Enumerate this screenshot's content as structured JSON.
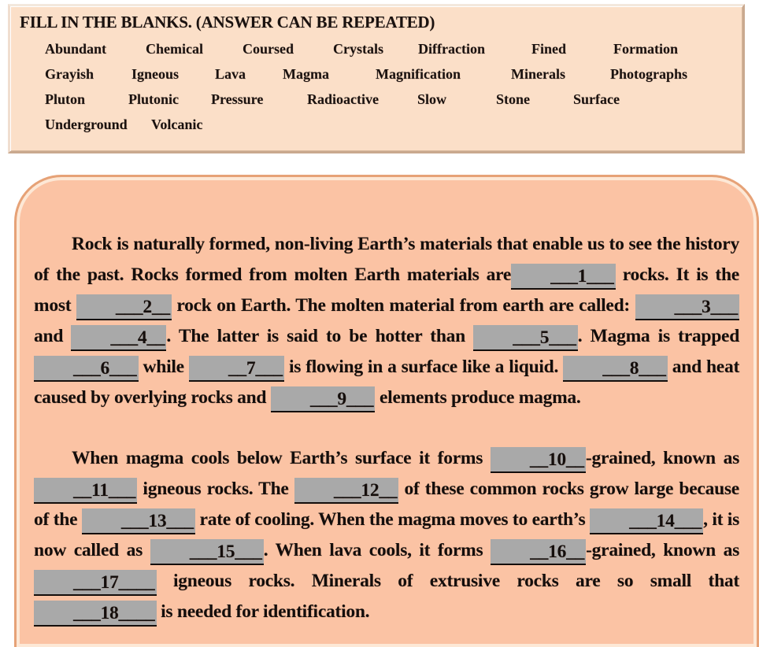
{
  "word_bank": {
    "title": "FILL IN THE BLANKS. (ANSWER CAN BE REPEATED)",
    "rows": [
      [
        "Abundant",
        "Chemical",
        "Coursed",
        "Crystals",
        "Diffraction",
        "Fined",
        "Formation"
      ],
      [
        "Grayish",
        "Igneous",
        "Lava",
        "Magma",
        "Magnification",
        "Minerals",
        "Photographs"
      ],
      [
        "Pluton",
        "Plutonic",
        "Pressure",
        "Radioactive",
        "Slow",
        "Stone",
        "Surface"
      ],
      [
        "Underground",
        "Volcanic"
      ]
    ]
  },
  "paragraphs": [
    {
      "id": "paragraph-one",
      "parts": [
        {
          "t": "text",
          "v": "Rock is naturally formed, non-living Earth’s materials that enable us to see the history of the past. Rocks formed from molten Earth materials are"
        },
        {
          "t": "blank",
          "v": "___1___"
        },
        {
          "t": "text",
          "v": " rocks. It is the most "
        },
        {
          "t": "blank",
          "v": "___2__"
        },
        {
          "t": "text",
          "v": " rock on Earth. The molten material from earth are called: "
        },
        {
          "t": "blank",
          "v": "___3___"
        },
        {
          "t": "text",
          "v": " and "
        },
        {
          "t": "blank",
          "v": "___4__"
        },
        {
          "t": "text",
          "v": ". The latter is said to be hotter than "
        },
        {
          "t": "blank",
          "v": "___5___"
        },
        {
          "t": "text",
          "v": ". Magma is trapped "
        },
        {
          "t": "blank",
          "v": "___6___"
        },
        {
          "t": "text",
          "v": " while "
        },
        {
          "t": "blank",
          "v": "__7___"
        },
        {
          "t": "text",
          "v": " is flowing in a surface like a liquid. "
        },
        {
          "t": "blank",
          "v": "___8___"
        },
        {
          "t": "text",
          "v": " and heat caused by overlying rocks and "
        },
        {
          "t": "blank",
          "v": "___9___"
        },
        {
          "t": "text",
          "v": " elements produce magma."
        }
      ]
    },
    {
      "id": "paragraph-two",
      "parts": [
        {
          "t": "text",
          "v": "When magma cools below Earth’s surface it forms "
        },
        {
          "t": "blank",
          "v": "__10__"
        },
        {
          "t": "text",
          "v": "-grained, known as "
        },
        {
          "t": "blank",
          "v": "__11___"
        },
        {
          "t": "text",
          "v": " igneous rocks. The "
        },
        {
          "t": "blank",
          "v": "___12__"
        },
        {
          "t": "text",
          "v": " of these common rocks grow large because of the "
        },
        {
          "t": "blank",
          "v": "___13___"
        },
        {
          "t": "text",
          "v": " rate of cooling. When the magma moves to earth’s "
        },
        {
          "t": "blank",
          "v": "___14___"
        },
        {
          "t": "text",
          "v": ", it is now called as "
        },
        {
          "t": "blank",
          "v": "___15___"
        },
        {
          "t": "text",
          "v": ". When lava cools, it forms "
        },
        {
          "t": "blank",
          "v": "__16__"
        },
        {
          "t": "text",
          "v": "-grained, known as "
        },
        {
          "t": "blank",
          "v": "___17____"
        },
        {
          "t": "text",
          "v": " igneous rocks. Minerals of extrusive rocks are so small that "
        },
        {
          "t": "blank",
          "v": "___18____"
        },
        {
          "t": "text",
          "v": " is needed for identification."
        }
      ]
    }
  ],
  "colors": {
    "word_bank_background": "#fbdfc8",
    "panel_background": "#fbc3a4",
    "panel_highlight_border": "#fde8d6",
    "panel_outer_border": "#e6a277",
    "blank_highlight": "#a9a9a9",
    "text": "#140e0c",
    "page_background": "#ffffff"
  }
}
